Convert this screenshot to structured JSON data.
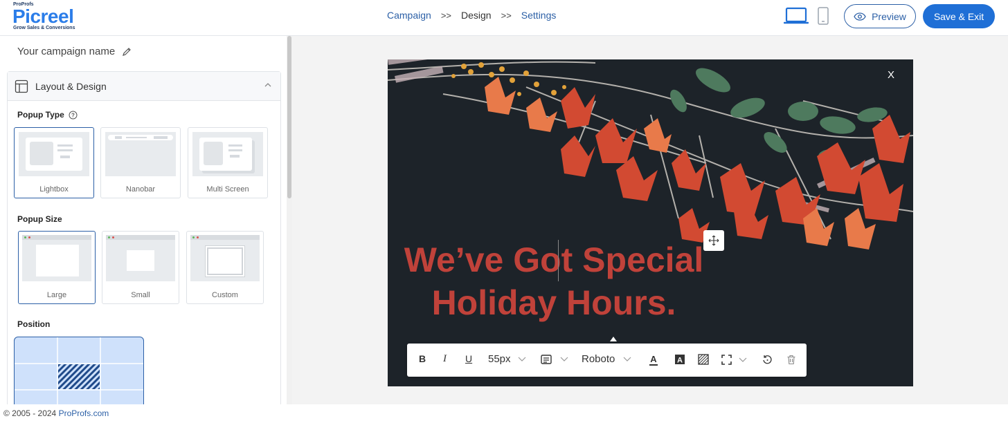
{
  "brand": {
    "proprofs": "ProProfs",
    "name": "Picreel",
    "tagline": "Grow Sales & Conversions",
    "color": "#2b7de9"
  },
  "breadcrumb": {
    "step1": "Campaign",
    "sep1": ">>",
    "step2": "Design",
    "sep2": ">>",
    "step3": "Settings"
  },
  "devices": [
    "desktop-icon",
    "mobile-icon"
  ],
  "header": {
    "preview_label": "Preview",
    "save_label": "Save & Exit"
  },
  "sidebar": {
    "campaign_name": "Your campaign name",
    "panel_title": "Layout & Design",
    "popup_type": {
      "title": "Popup Type",
      "options": [
        "Lightbox",
        "Nanobar",
        "Multi Screen"
      ],
      "selected": "Lightbox"
    },
    "popup_size": {
      "title": "Popup Size",
      "options": [
        "Large",
        "Small",
        "Custom"
      ],
      "selected": "Large"
    },
    "position": {
      "title": "Position"
    }
  },
  "popup": {
    "close_label": "X",
    "headline_line1": "We’ve Got Special",
    "headline_line2": "Holiday Hours.",
    "headline_color": "#c0423a",
    "background_color": "#1d2329"
  },
  "text_toolbar": {
    "bold": "B",
    "italic": "I",
    "underline": "U",
    "font_size": "55px",
    "font_family": "Roboto"
  },
  "footer": {
    "copyright": "© 2005 - 2024",
    "link": "ProProfs.com"
  }
}
